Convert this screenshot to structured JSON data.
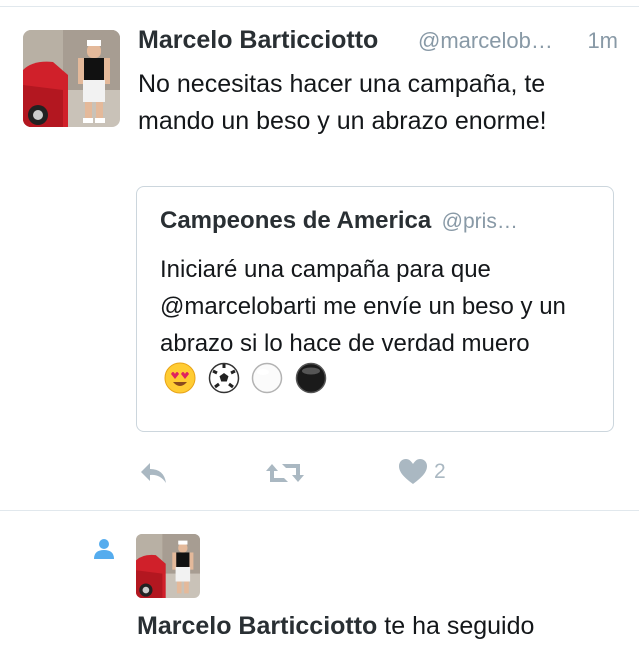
{
  "tweet": {
    "author_name": "Marcelo Barticciotto",
    "author_handle": "@marcelob…",
    "timestamp": "1m",
    "text": "No necesitas hacer una campaña, te mando un beso y un abrazo enorme!",
    "quote": {
      "author_name": "Campeones de America",
      "author_handle": "@pris…",
      "text": "Iniciaré una campaña para que @marcelobarti me envíe un beso y un abrazo si lo hace de verdad muero",
      "emojis": [
        "heart-eyes-emoji",
        "soccer-ball-emoji",
        "white-circle-emoji",
        "black-circle-emoji"
      ]
    },
    "actions": {
      "reply_icon": "reply-icon",
      "retweet_icon": "retweet-icon",
      "like_icon": "heart-icon",
      "like_count": "2"
    }
  },
  "notification": {
    "icon": "person-icon",
    "actor_name": "Marcelo Barticciotto",
    "action_text": "te ha seguido"
  },
  "colors": {
    "text": "#14171a",
    "secondary": "#8899a6",
    "action_gray": "#aab8c2",
    "follow_blue": "#55acee",
    "border": "#ccd6dd"
  }
}
